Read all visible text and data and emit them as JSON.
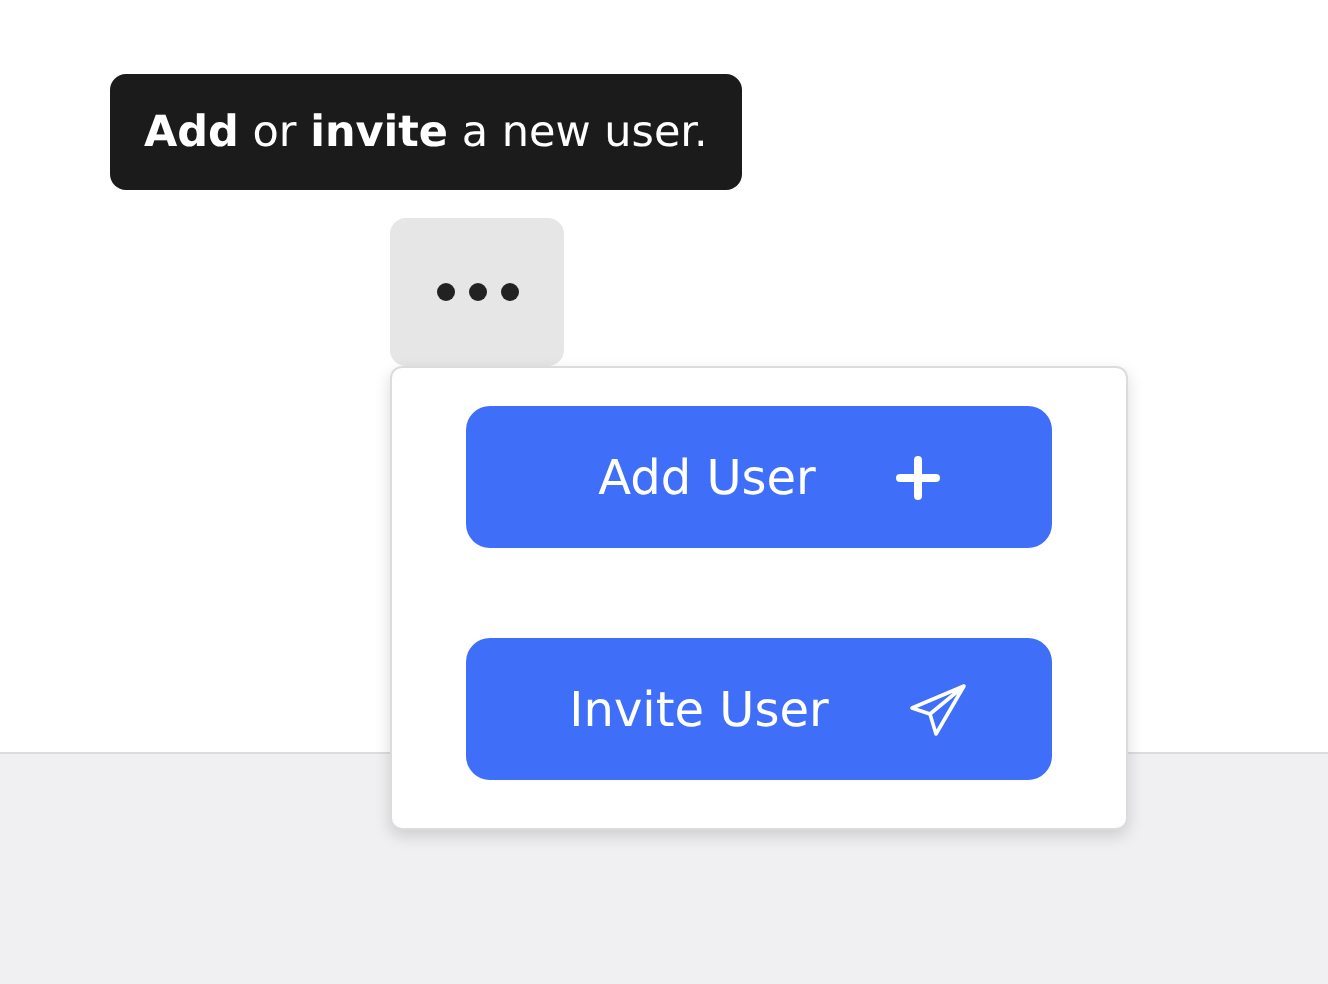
{
  "tooltip": {
    "text": "**Add** or **invite** a new user."
  },
  "menu": {
    "expanded": true,
    "items": [
      {
        "kind": "add",
        "label": "Add User"
      },
      {
        "kind": "invite",
        "label": "Invite User"
      }
    ]
  }
}
